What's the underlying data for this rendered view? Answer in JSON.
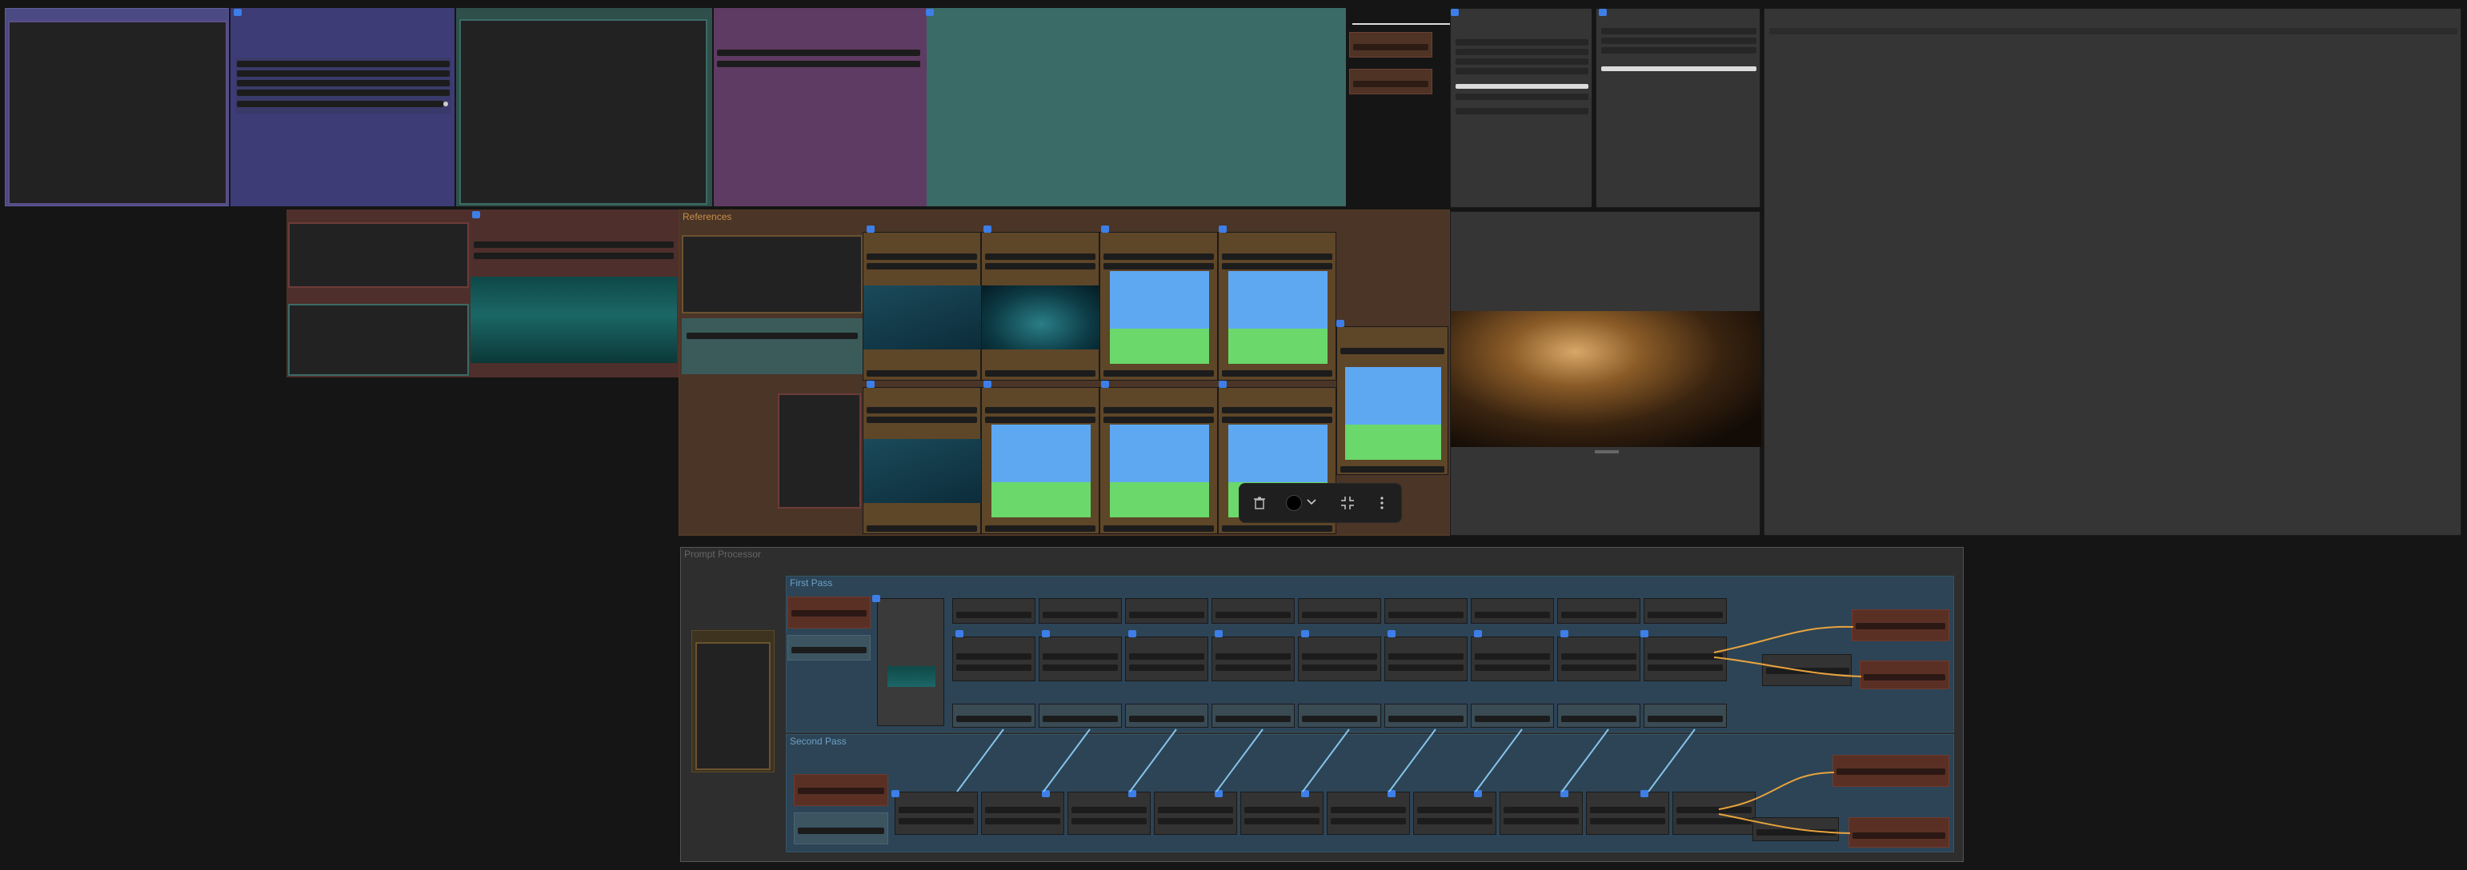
{
  "groups": {
    "references": "References",
    "prompt_processor": "Prompt Processor",
    "first_pass": "First Pass",
    "second_pass": "Second Pass"
  },
  "toolbar": {
    "delete_icon": "trash-icon",
    "color_icon": "color-circle-icon",
    "chevron_icon": "chevron-down-icon",
    "fit_icon": "fit-view-icon",
    "more_icon": "more-vertical-icon",
    "color_value": "#000000"
  },
  "colors": {
    "canvas": "#151515",
    "accent": "#3d7ee8",
    "references_group": "#5a3b24",
    "prompt_group": "#333333",
    "pass_group": "#2f4a5a",
    "link_blue": "#86c3e8",
    "link_orange": "#e8a33d"
  }
}
